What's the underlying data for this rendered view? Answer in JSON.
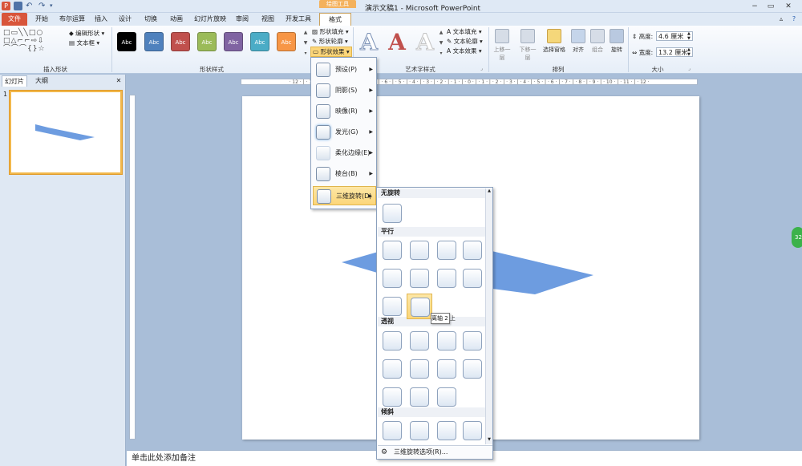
{
  "window": {
    "title": "演示文稿1 - Microsoft PowerPoint",
    "context_tab": "绘图工具",
    "controls": [
      "−",
      "▭",
      "✕"
    ]
  },
  "tabs": [
    "文件",
    "开始",
    "布尔运算",
    "插入",
    "设计",
    "切换",
    "动画",
    "幻灯片放映",
    "审阅",
    "视图",
    "开发工具",
    "格式"
  ],
  "ribbon": {
    "insert_shapes": {
      "edit_shape": "编辑形状",
      "text_box": "文本框",
      "label": "插入形状"
    },
    "shape_styles": {
      "swatch_text": "Abc",
      "swatches": [
        "#000000",
        "#4f81bd",
        "#c0504d",
        "#9bbb59",
        "#8064a2",
        "#4bacc6",
        "#f79646"
      ],
      "fill": "形状填充",
      "outline": "形状轮廓",
      "effects": "形状效果",
      "label": "形状样式"
    },
    "wordart": {
      "letter": "A",
      "text_fill": "文本填充",
      "text_outline": "文本轮廓",
      "text_effects": "文本效果",
      "label": "艺术字样式"
    },
    "arrange": {
      "bring_forward": "上移一层",
      "send_backward": "下移一层",
      "selection_pane": "选择窗格",
      "align": "对齐",
      "group": "组合",
      "rotate": "旋转",
      "label": "排列"
    },
    "size": {
      "height_label": "高度:",
      "height": "4.6 厘米",
      "width_label": "宽度:",
      "width": "13.2 厘米",
      "label": "大小"
    }
  },
  "left_pane": {
    "tab_slides": "幻灯片",
    "tab_outline": "大纲",
    "close": "✕",
    "slide_number": "1"
  },
  "ruler_text": "· 12 · | · 11 · | · 10 · | · 9 · | · 8 · | · 7 · | · 6 · | · 5 · | · 4 · | · 3 · | · 2 · | · 1 · | · 0 · | · 1 · | · 2 · | · 3 · | · 4 · | · 5 · | · 6 · | · 7 · | · 8 · | · 9 · | · 10 · | · 11 · | · 12 ·",
  "effects_menu": {
    "items": [
      "预设(P)",
      "阴影(S)",
      "映像(R)",
      "发光(G)",
      "柔化边缘(E)",
      "棱台(B)",
      "三维旋转(D)"
    ],
    "highlighted_index": 6
  },
  "rotation_gallery": {
    "sections": {
      "none": "无旋转",
      "parallel": "平行",
      "perspective": "透视",
      "oblique": "倾斜"
    },
    "footer": "三维旋转选项(R)...",
    "tooltip": "离轴 2 上"
  },
  "notes_placeholder": "单击此处添加备注",
  "badge": "32",
  "colors": {
    "shape_fill": "#6d9ce0",
    "accent_file_tab": "#d8553b",
    "context_tab": "#f4b15c",
    "hover": "#fcd679"
  }
}
